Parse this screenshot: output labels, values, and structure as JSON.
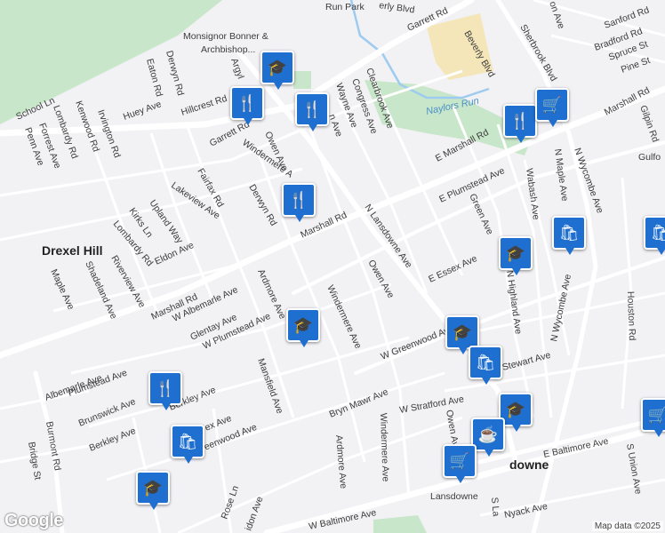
{
  "map": {
    "colors": {
      "land": "#f2f1f4",
      "park": "#c8e6c9",
      "road": "#ffffff",
      "water": "#9ecbf0",
      "marker": "#1e6fd0",
      "campus": "#f4e6b8"
    },
    "place_labels": {
      "drexel_hill": "Drexel Hill",
      "lansdowne": "Lansdowne",
      "lansdowne_station": "Lansdowne",
      "run_park": "Run Park",
      "monsignor": "Monsignor Bonner &",
      "archbishop": "Archbishop...",
      "naylors_run": "Naylors Run"
    },
    "street_labels": {
      "garrett_rd_top": "Garrett Rd",
      "beverly_blvd": "Beverly Blvd",
      "erly_blvd": "erly Blvd",
      "sherbrook_blvd": "Sherbrook Blvd",
      "sanford_rd": "Sanford Rd",
      "bradford_rd": "Bradford Rd",
      "spruce_st": "Spruce St",
      "pine_st": "Pine St",
      "on_ave": "on Ave",
      "hillcrest_rd": "Hillcrest Rd",
      "derwyn_rd_top": "Derwyn Rd",
      "eaton_rd": "Eaton Rd",
      "argyle": "Argyl",
      "congress_ave": "Congress Ave",
      "clearbrook_ave": "Clearbrook Ave",
      "wayne_ave": "Wayne Ave",
      "n_ave": "n Ave",
      "school_ln": "School Ln",
      "lombardy_rd_top": "Lombardy Rd",
      "kenwood_rd": "Kenwood Rd",
      "irvington_rd": "Irvington Rd",
      "huey_ave": "Huey Ave",
      "penn_ave": "Penn Ave",
      "forrest_ave": "Forrest Ave",
      "garrett_rd": "Garrett Rd",
      "owen_ave_top": "Owen Ave",
      "windermere_top": "Windermere A",
      "e_marshall_rd": "E Marshall Rd",
      "marshall_rd_top": "Marshall Rd",
      "gilpin_rd": "Gilpin Rd",
      "gulfo": "Gulfo",
      "n_maple_ave": "N Maple Ave",
      "n_wycombe_ave_top": "N Wycombe Ave",
      "wabash_ave": "Wabash Ave",
      "e_plumstead_ave": "E Plumstead Ave",
      "fairfax_rd": "Fairfax Rd",
      "lakeview_ave": "Lakeview Ave",
      "derwyn_rd": "Derwyn Rd",
      "marshall_rd": "Marshall Rd",
      "n_lansdowne_ave": "N Lansdowne Ave",
      "green_ave": "Green Ave",
      "upland_way": "Upland Way",
      "kirks_ln": "Kirks Ln",
      "lombardy_rd": "Lombardy Rd",
      "eldon_ave": "Eldon Ave",
      "riverview_ave": "Riverview Ave",
      "e_essex_ave": "E Essex Ave",
      "n_highland_ave": "N Highland Ave",
      "n_wycombe_ave": "N Wycombe Ave",
      "houston_rd": "Houston Rd",
      "shadeland_ave": "Shadeland Ave",
      "maple_ave": "Maple Ave",
      "marshall_rd_left": "Marshall Rd",
      "w_albemarle_ave": "W Albemarle Ave",
      "ardmore_ave": "Ardmore Ave",
      "owen_ave": "Owen Ave",
      "glentay_ave": "Glentay Ave",
      "w_plumstead_ave": "W Plumstead Ave",
      "windermere_ave": "Windermere Ave",
      "w_greenwood_ave": "W Greenwood Ave",
      "stewart_ave": "Stewart Ave",
      "albemarle_ave": "Albemarle Ave",
      "plumstead_ave": "Plumstead Ave",
      "brunswick_ave": "Brunswick Ave",
      "berkley_ave": "Berkley Ave",
      "berkley_ave2": "Berkley Ave",
      "burmont_rd": "Burmont Rd",
      "mansfield_ave": "Mansfield Ave",
      "bryn_mawr_ave": "Bryn Mawr Ave",
      "w_stratford_ave": "W Stratford Ave",
      "owen_ave_bottom": "Owen Av",
      "windermere_bottom": "Windermere Ave",
      "ex_ave": "ex Ave",
      "reenwood_ave": "reenwood Ave",
      "ardmore_bottom": "Ardmore Ave",
      "e_baltimore_ave": "E Baltimore Ave",
      "s_union_ave": "S Union Ave",
      "downe": "downe",
      "bridge_st": "Bridge St",
      "rose_ln": "Rose Ln",
      "idon_ave": "idon Ave",
      "w_baltimore_ave": "W Baltimore Ave",
      "nyack_ave": "Nyack Ave",
      "s_la": "S La"
    },
    "markers": [
      {
        "type": "school",
        "icon": "graduation-cap-icon",
        "glyph": "🎓"
      },
      {
        "type": "restaurant",
        "icon": "fork-knife-icon",
        "glyph": "🍴"
      },
      {
        "type": "restaurant",
        "icon": "fork-knife-icon",
        "glyph": "🍴"
      },
      {
        "type": "restaurant",
        "icon": "fork-knife-icon",
        "glyph": "🍴"
      },
      {
        "type": "restaurant",
        "icon": "fork-knife-icon",
        "glyph": "🍴"
      },
      {
        "type": "shopping",
        "icon": "cart-icon",
        "glyph": "🛒"
      },
      {
        "type": "school",
        "icon": "graduation-cap-icon",
        "glyph": "🎓"
      },
      {
        "type": "store",
        "icon": "shopping-bag-icon",
        "glyph": "🛍"
      },
      {
        "type": "school",
        "icon": "graduation-cap-icon",
        "glyph": "🎓"
      },
      {
        "type": "school",
        "icon": "graduation-cap-icon",
        "glyph": "🎓"
      },
      {
        "type": "store",
        "icon": "shopping-bag-icon",
        "glyph": "🛍"
      },
      {
        "type": "restaurant",
        "icon": "fork-knife-icon",
        "glyph": "🍴"
      },
      {
        "type": "store",
        "icon": "shopping-bag-icon",
        "glyph": "🛍"
      },
      {
        "type": "school",
        "icon": "graduation-cap-icon",
        "glyph": "🎓"
      },
      {
        "type": "cafe",
        "icon": "coffee-icon",
        "glyph": "☕"
      },
      {
        "type": "shopping",
        "icon": "cart-icon",
        "glyph": "🛒"
      },
      {
        "type": "school",
        "icon": "graduation-cap-icon",
        "glyph": "🎓"
      },
      {
        "type": "shopping",
        "icon": "cart-icon",
        "glyph": "🛒"
      },
      {
        "type": "store",
        "icon": "shopping-bag-icon",
        "glyph": "🛍"
      }
    ],
    "attribution": {
      "logo": "Google",
      "data": "Map data ©2025"
    }
  }
}
